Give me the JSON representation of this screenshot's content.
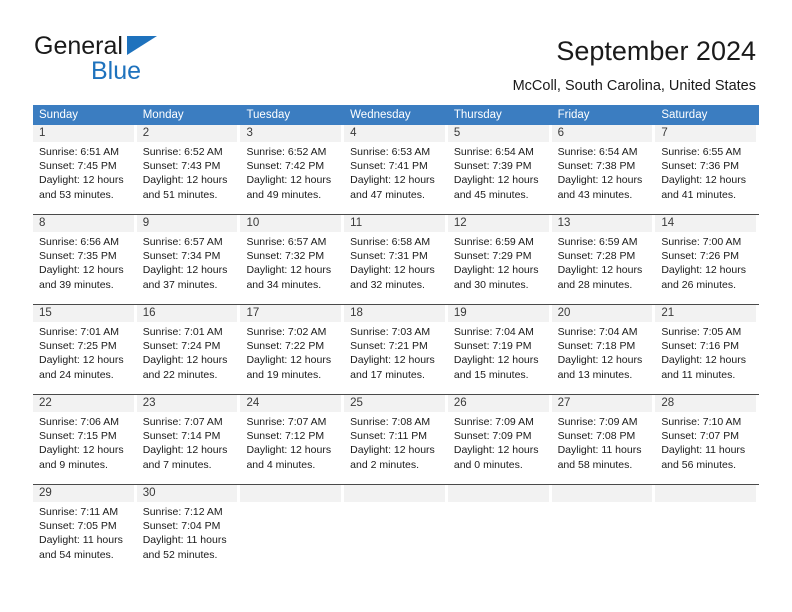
{
  "brand": {
    "name_top": "General",
    "name_bottom": "Blue",
    "accent_color": "#1e72bd"
  },
  "header": {
    "title": "September 2024",
    "subtitle": "McColl, South Carolina, United States",
    "weekday_header_color": "#3b7dc1"
  },
  "calendar": {
    "weekdays": [
      "Sunday",
      "Monday",
      "Tuesday",
      "Wednesday",
      "Thursday",
      "Friday",
      "Saturday"
    ],
    "weeks": [
      [
        {
          "day": "1",
          "sunrise": "Sunrise: 6:51 AM",
          "sunset": "Sunset: 7:45 PM",
          "daylight": "Daylight: 12 hours and 53 minutes."
        },
        {
          "day": "2",
          "sunrise": "Sunrise: 6:52 AM",
          "sunset": "Sunset: 7:43 PM",
          "daylight": "Daylight: 12 hours and 51 minutes."
        },
        {
          "day": "3",
          "sunrise": "Sunrise: 6:52 AM",
          "sunset": "Sunset: 7:42 PM",
          "daylight": "Daylight: 12 hours and 49 minutes."
        },
        {
          "day": "4",
          "sunrise": "Sunrise: 6:53 AM",
          "sunset": "Sunset: 7:41 PM",
          "daylight": "Daylight: 12 hours and 47 minutes."
        },
        {
          "day": "5",
          "sunrise": "Sunrise: 6:54 AM",
          "sunset": "Sunset: 7:39 PM",
          "daylight": "Daylight: 12 hours and 45 minutes."
        },
        {
          "day": "6",
          "sunrise": "Sunrise: 6:54 AM",
          "sunset": "Sunset: 7:38 PM",
          "daylight": "Daylight: 12 hours and 43 minutes."
        },
        {
          "day": "7",
          "sunrise": "Sunrise: 6:55 AM",
          "sunset": "Sunset: 7:36 PM",
          "daylight": "Daylight: 12 hours and 41 minutes."
        }
      ],
      [
        {
          "day": "8",
          "sunrise": "Sunrise: 6:56 AM",
          "sunset": "Sunset: 7:35 PM",
          "daylight": "Daylight: 12 hours and 39 minutes."
        },
        {
          "day": "9",
          "sunrise": "Sunrise: 6:57 AM",
          "sunset": "Sunset: 7:34 PM",
          "daylight": "Daylight: 12 hours and 37 minutes."
        },
        {
          "day": "10",
          "sunrise": "Sunrise: 6:57 AM",
          "sunset": "Sunset: 7:32 PM",
          "daylight": "Daylight: 12 hours and 34 minutes."
        },
        {
          "day": "11",
          "sunrise": "Sunrise: 6:58 AM",
          "sunset": "Sunset: 7:31 PM",
          "daylight": "Daylight: 12 hours and 32 minutes."
        },
        {
          "day": "12",
          "sunrise": "Sunrise: 6:59 AM",
          "sunset": "Sunset: 7:29 PM",
          "daylight": "Daylight: 12 hours and 30 minutes."
        },
        {
          "day": "13",
          "sunrise": "Sunrise: 6:59 AM",
          "sunset": "Sunset: 7:28 PM",
          "daylight": "Daylight: 12 hours and 28 minutes."
        },
        {
          "day": "14",
          "sunrise": "Sunrise: 7:00 AM",
          "sunset": "Sunset: 7:26 PM",
          "daylight": "Daylight: 12 hours and 26 minutes."
        }
      ],
      [
        {
          "day": "15",
          "sunrise": "Sunrise: 7:01 AM",
          "sunset": "Sunset: 7:25 PM",
          "daylight": "Daylight: 12 hours and 24 minutes."
        },
        {
          "day": "16",
          "sunrise": "Sunrise: 7:01 AM",
          "sunset": "Sunset: 7:24 PM",
          "daylight": "Daylight: 12 hours and 22 minutes."
        },
        {
          "day": "17",
          "sunrise": "Sunrise: 7:02 AM",
          "sunset": "Sunset: 7:22 PM",
          "daylight": "Daylight: 12 hours and 19 minutes."
        },
        {
          "day": "18",
          "sunrise": "Sunrise: 7:03 AM",
          "sunset": "Sunset: 7:21 PM",
          "daylight": "Daylight: 12 hours and 17 minutes."
        },
        {
          "day": "19",
          "sunrise": "Sunrise: 7:04 AM",
          "sunset": "Sunset: 7:19 PM",
          "daylight": "Daylight: 12 hours and 15 minutes."
        },
        {
          "day": "20",
          "sunrise": "Sunrise: 7:04 AM",
          "sunset": "Sunset: 7:18 PM",
          "daylight": "Daylight: 12 hours and 13 minutes."
        },
        {
          "day": "21",
          "sunrise": "Sunrise: 7:05 AM",
          "sunset": "Sunset: 7:16 PM",
          "daylight": "Daylight: 12 hours and 11 minutes."
        }
      ],
      [
        {
          "day": "22",
          "sunrise": "Sunrise: 7:06 AM",
          "sunset": "Sunset: 7:15 PM",
          "daylight": "Daylight: 12 hours and 9 minutes."
        },
        {
          "day": "23",
          "sunrise": "Sunrise: 7:07 AM",
          "sunset": "Sunset: 7:14 PM",
          "daylight": "Daylight: 12 hours and 7 minutes."
        },
        {
          "day": "24",
          "sunrise": "Sunrise: 7:07 AM",
          "sunset": "Sunset: 7:12 PM",
          "daylight": "Daylight: 12 hours and 4 minutes."
        },
        {
          "day": "25",
          "sunrise": "Sunrise: 7:08 AM",
          "sunset": "Sunset: 7:11 PM",
          "daylight": "Daylight: 12 hours and 2 minutes."
        },
        {
          "day": "26",
          "sunrise": "Sunrise: 7:09 AM",
          "sunset": "Sunset: 7:09 PM",
          "daylight": "Daylight: 12 hours and 0 minutes."
        },
        {
          "day": "27",
          "sunrise": "Sunrise: 7:09 AM",
          "sunset": "Sunset: 7:08 PM",
          "daylight": "Daylight: 11 hours and 58 minutes."
        },
        {
          "day": "28",
          "sunrise": "Sunrise: 7:10 AM",
          "sunset": "Sunset: 7:07 PM",
          "daylight": "Daylight: 11 hours and 56 minutes."
        }
      ],
      [
        {
          "day": "29",
          "sunrise": "Sunrise: 7:11 AM",
          "sunset": "Sunset: 7:05 PM",
          "daylight": "Daylight: 11 hours and 54 minutes."
        },
        {
          "day": "30",
          "sunrise": "Sunrise: 7:12 AM",
          "sunset": "Sunset: 7:04 PM",
          "daylight": "Daylight: 11 hours and 52 minutes."
        },
        {
          "day": "",
          "sunrise": "",
          "sunset": "",
          "daylight": ""
        },
        {
          "day": "",
          "sunrise": "",
          "sunset": "",
          "daylight": ""
        },
        {
          "day": "",
          "sunrise": "",
          "sunset": "",
          "daylight": ""
        },
        {
          "day": "",
          "sunrise": "",
          "sunset": "",
          "daylight": ""
        },
        {
          "day": "",
          "sunrise": "",
          "sunset": "",
          "daylight": ""
        }
      ]
    ]
  }
}
